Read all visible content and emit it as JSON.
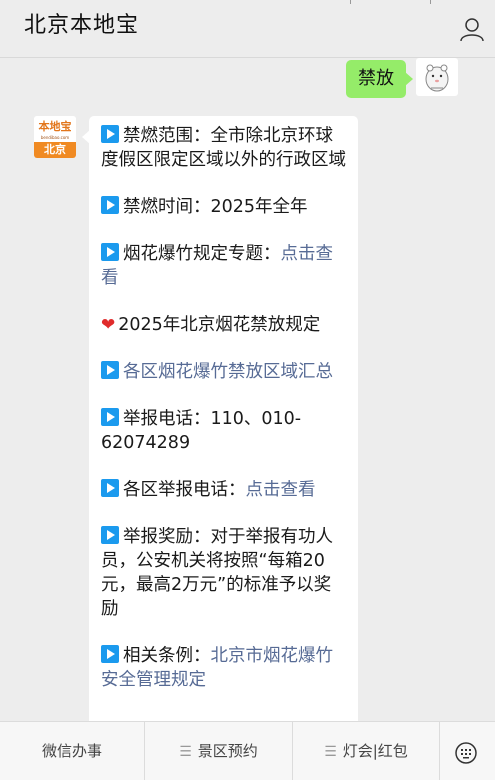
{
  "header": {
    "title": "北京本地宝"
  },
  "user_message": {
    "text": "禁放"
  },
  "bot": {
    "avatar_top": "本地宝",
    "avatar_sub": "bendibao.com",
    "avatar_bottom": "北京",
    "paragraphs": [
      {
        "label": "禁燃范围：",
        "text": "全市除北京环球度假区限定区域以外的行政区域"
      },
      {
        "label": "禁燃时间：",
        "text": "2025年全年"
      },
      {
        "label": "烟花爆竹规定专题：",
        "link": "点击查看"
      },
      {
        "heart_text": "2025年北京烟花禁放规定"
      },
      {
        "link_only": "各区烟花爆竹禁放区域汇总"
      },
      {
        "label": "举报电话：",
        "text": "110、010-62074289"
      },
      {
        "label": "各区举报电话：",
        "link": "点击查看"
      },
      {
        "label": "举报奖励：",
        "text": "对于举报有功人员，公安机关将按照“每箱20元，最高2万元”的标准予以奖励"
      },
      {
        "label": "相关条例：",
        "link": "北京市烟花爆竹安全管理规定"
      }
    ]
  },
  "bottom_bar": {
    "tabs": [
      "微信办事",
      "景区预约",
      "灯会|红包"
    ]
  }
}
